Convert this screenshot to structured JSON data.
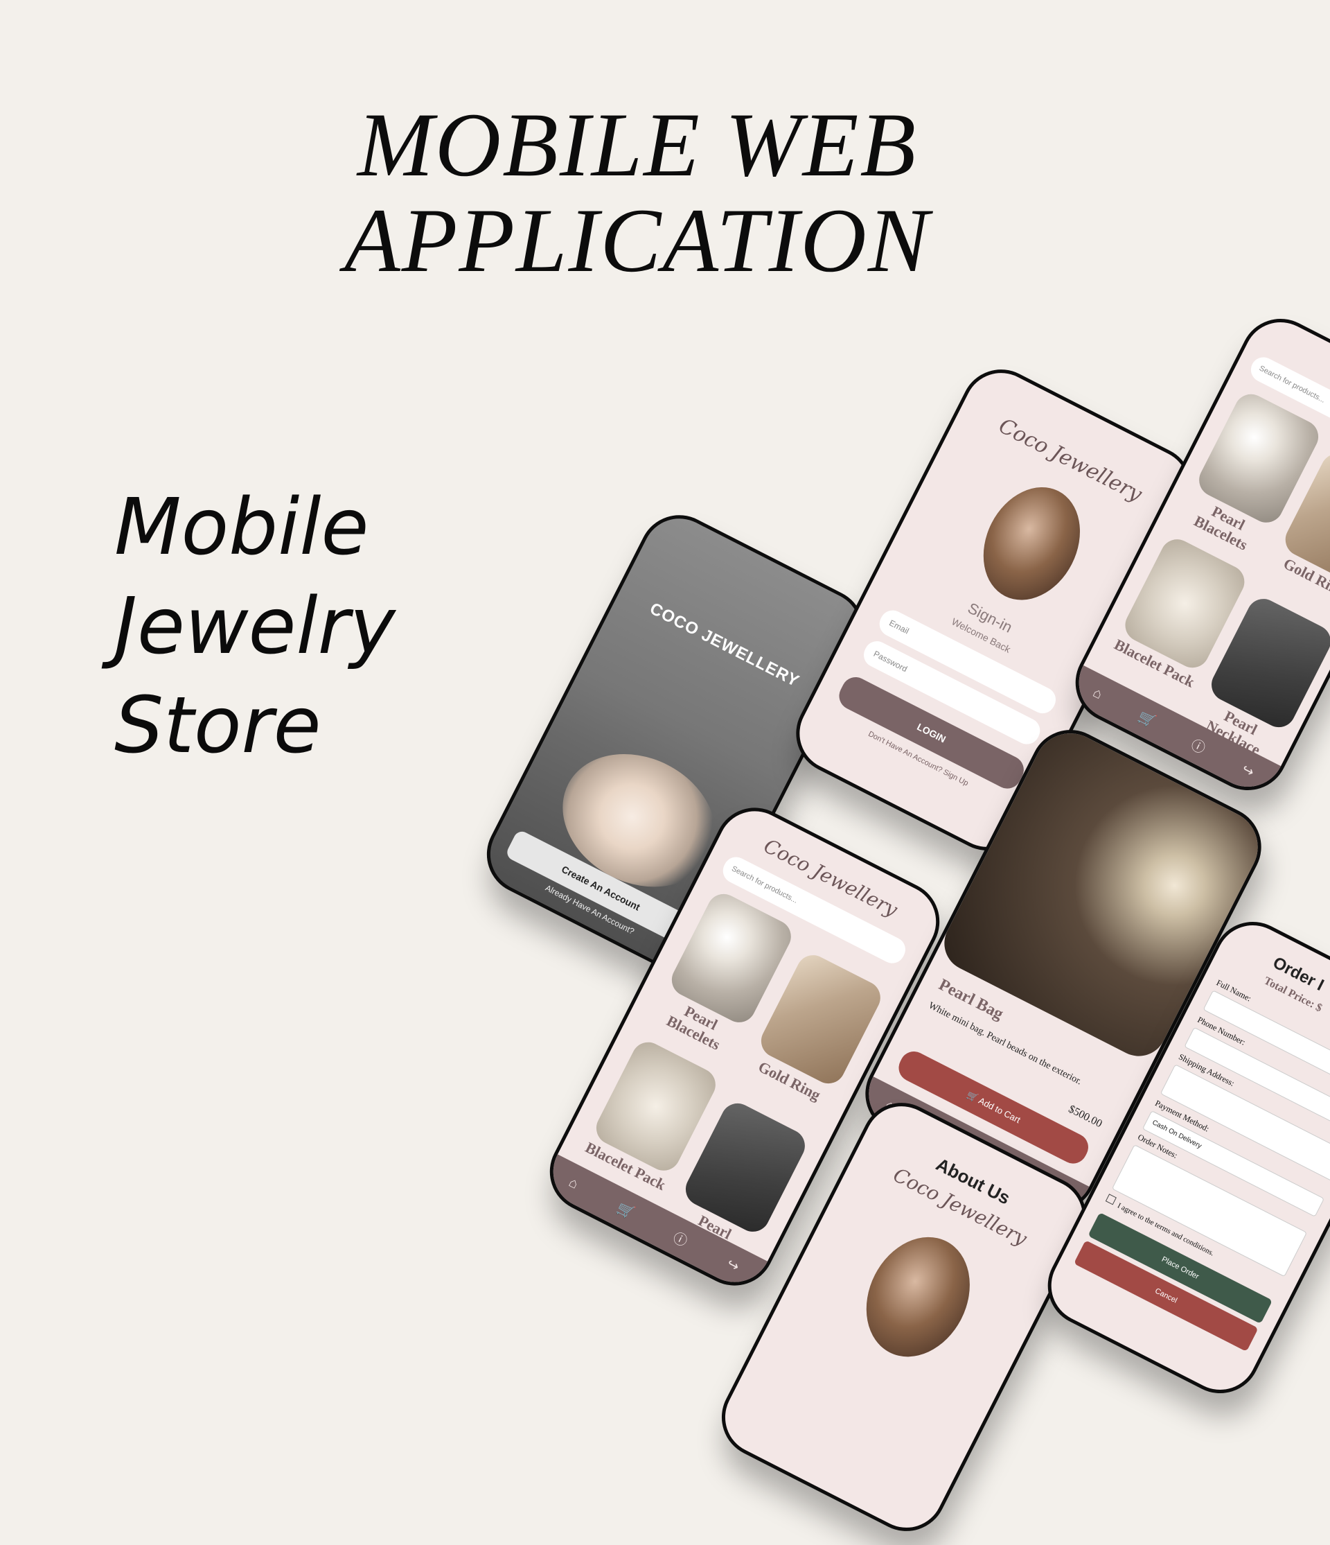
{
  "headline": {
    "line1": "MOBILE WEB",
    "line2": "APPLICATION"
  },
  "subtitle": {
    "line1": "Mobile",
    "line2": "Jewelry",
    "line3": "Store"
  },
  "welcome_screen": {
    "brand": "COCO JEWELLERY",
    "create_account": "Create An Account",
    "already_account": "Already Have An Account?"
  },
  "signin_screen": {
    "logo": "Coco Jewellery",
    "title": "Sign-in",
    "subtitle": "Welcome Back",
    "email_placeholder": "Email",
    "password_placeholder": "Password",
    "login_button": "LOGIN",
    "signup_link": "Don't Have An Account? Sign Up"
  },
  "shop_screen": {
    "logo": "Coco Jewellery",
    "search_placeholder": "Search for products...",
    "products": [
      {
        "name": "Pearl Blacelets"
      },
      {
        "name": "Gold Ring"
      },
      {
        "name": "Blacelet Pack"
      },
      {
        "name": "Pearl Necklace"
      }
    ]
  },
  "product_screen": {
    "name": "Pearl Bag",
    "description": "White mini bag. Pearl beads on the exterior.",
    "price": "$500.00",
    "add_to_cart": "Add to Cart"
  },
  "about_screen": {
    "title": "About Us",
    "logo": "Coco Jewellery"
  },
  "order_screen": {
    "title": "Order I",
    "total_label": "Total Price: $",
    "full_name": "Full Name:",
    "phone": "Phone Number:",
    "shipping": "Shipping Address:",
    "payment": "Payment Method:",
    "payment_value": "Cash On Delivery",
    "notes": "Order Notes:",
    "terms": "I agree to the terms and conditions.",
    "place_order": "Place Order",
    "cancel": "Cancel"
  },
  "nav_icons": [
    "home-icon",
    "cart-icon",
    "info-icon",
    "logout-icon"
  ],
  "colors": {
    "background": "#f3f0eb",
    "screen_pink": "#f3e7e6",
    "mauve": "#7a6466",
    "red_button": "#a24a45",
    "green_button": "#3f5a4a"
  }
}
